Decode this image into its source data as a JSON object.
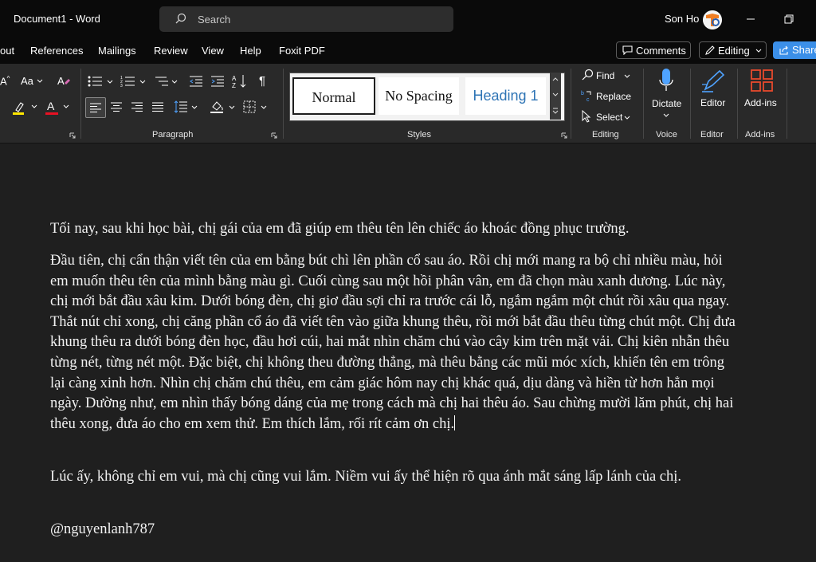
{
  "app": {
    "title": "Document1  -  Word",
    "user": "Son Ho"
  },
  "search": {
    "placeholder": "Search"
  },
  "menu": {
    "tabs": [
      "out",
      "References",
      "Mailings",
      "Review",
      "View",
      "Help",
      "Foxit PDF"
    ]
  },
  "actions": {
    "comments": "Comments",
    "editing": "Editing",
    "share": "Share"
  },
  "ribbon": {
    "groups": {
      "paragraph": "Paragraph",
      "styles": "Styles",
      "editing": "Editing",
      "voice": "Voice",
      "editor": "Editor",
      "addins": "Add-ins"
    },
    "styles": [
      "Normal",
      "No Spacing",
      "Heading 1"
    ],
    "editing_items": {
      "find": "Find",
      "replace": "Replace",
      "select": "Select"
    },
    "dictate": "Dictate",
    "editor": "Editor",
    "addins": "Add-ins",
    "font_case": "Aa",
    "pilcrow": "¶"
  },
  "document": {
    "paragraphs": [
      "Tối nay, sau khi học bài, chị gái của em đã giúp em thêu tên lên chiếc áo khoác đồng phục trường.",
      "Đầu tiên, chị cẩn thận viết tên của em bằng bút chì lên phần cổ sau áo. Rồi chị mới mang ra bộ chỉ nhiều màu, hỏi em muốn thêu tên của mình bằng màu gì. Cuối cùng sau một hồi phân vân, em đã chọn màu xanh dương. Lúc này, chị mới bắt đầu xâu kim. Dưới bóng đèn, chị giơ đầu sợi chỉ ra trước cái lỗ, ngắm ngắm một chút rồi xâu qua ngay. Thắt nút chỉ xong, chị căng phần cổ áo đã viết tên vào giữa khung thêu, rồi mới bắt đầu thêu từng chút một. Chị đưa khung thêu ra dưới bóng đèn học, đầu hơi cúi, hai mắt nhìn chăm chú vào cây kim trên mặt vải. Chị kiên nhẫn thêu từng nét, từng nét một. Đặc biệt, chị không theu đường thẳng, mà thêu bằng các mũi móc xích, khiến tên em trông lại càng xinh hơn. Nhìn chị chăm chú thêu, em cảm giác hôm nay chị khác quá, dịu dàng và hiền từ hơn hẳn mọi ngày. Dường như, em nhìn thấy bóng dáng của mẹ trong cách mà chị hai thêu áo. Sau chừng mười lăm phút, chị hai thêu xong, đưa áo cho em xem thử. Em thích lắm, rối rít cảm ơn chị.",
      "Lúc ấy, không chỉ em vui, mà chị cũng vui lắm. Niềm vui ấy thể hiện rõ qua ánh mắt sáng lấp lánh của chị.",
      "@nguyenlanh787"
    ]
  },
  "colors": {
    "accent": "#3b8fe8",
    "highlight": "#ffe600",
    "font_color": "#e81123",
    "heading": "#2e74b5"
  }
}
